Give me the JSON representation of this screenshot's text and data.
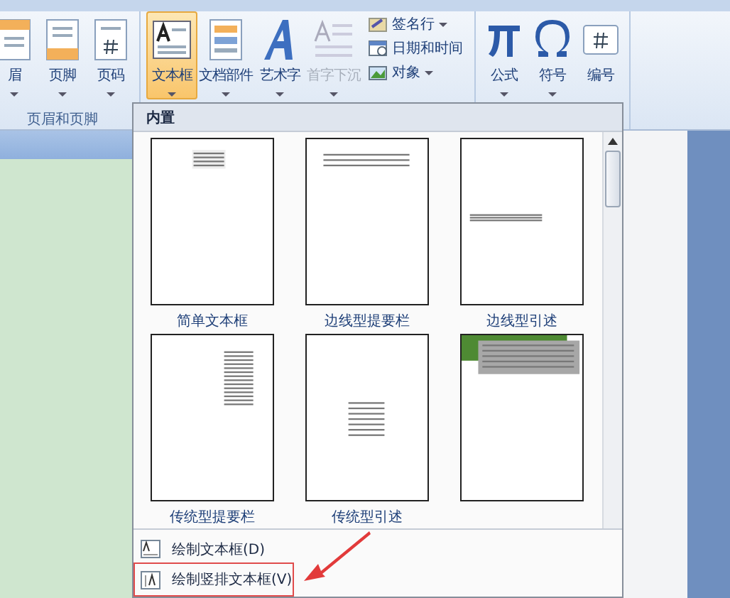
{
  "ribbon": {
    "groups": [
      {
        "label": "页眉和页脚",
        "buttons": [
          {
            "label": "眉",
            "dropdown": true,
            "selected": false,
            "disabled": false
          },
          {
            "label": "页脚",
            "dropdown": true,
            "selected": false,
            "disabled": false
          },
          {
            "label": "页码",
            "dropdown": true,
            "selected": false,
            "disabled": false
          }
        ]
      },
      {
        "buttons": [
          {
            "label": "文本框",
            "dropdown": true,
            "selected": true,
            "disabled": false
          },
          {
            "label": "文档部件",
            "dropdown": true,
            "selected": false,
            "disabled": false
          },
          {
            "label": "艺术字",
            "dropdown": true,
            "selected": false,
            "disabled": false
          },
          {
            "label": "首字下沉",
            "dropdown": true,
            "selected": false,
            "disabled": true
          }
        ],
        "small_buttons": [
          {
            "label": "签名行",
            "dropdown": true
          },
          {
            "label": "日期和时间",
            "dropdown": false
          },
          {
            "label": "对象",
            "dropdown": true
          }
        ]
      },
      {
        "buttons": [
          {
            "label": "公式",
            "dropdown": true,
            "selected": false,
            "disabled": false
          },
          {
            "label": "符号",
            "dropdown": true,
            "selected": false,
            "disabled": false
          },
          {
            "label": "编号",
            "dropdown": false,
            "selected": false,
            "disabled": false
          }
        ]
      }
    ]
  },
  "gallery": {
    "header": "内置",
    "items": [
      {
        "label": "简单文本框",
        "kind": "simple"
      },
      {
        "label": "边线型提要栏",
        "kind": "top-lines"
      },
      {
        "label": "边线型引述",
        "kind": "middle-quote"
      },
      {
        "label": "传统型提要栏",
        "kind": "side-bar"
      },
      {
        "label": "传统型引述",
        "kind": "center-quote"
      },
      {
        "kind": "green-header"
      }
    ],
    "menu": [
      {
        "label": "绘制文本框(D)",
        "highlighted": false
      },
      {
        "label": "绘制竖排文本框(V)",
        "highlighted": true
      }
    ]
  }
}
